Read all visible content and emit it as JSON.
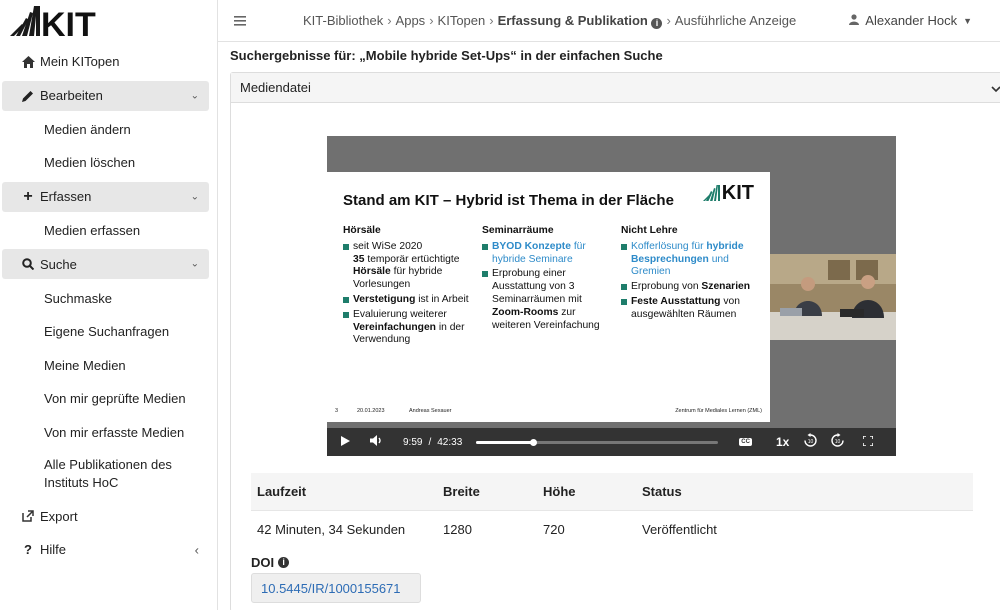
{
  "header": {
    "breadcrumb": [
      "KIT-Bibliothek",
      "Apps",
      "KITopen",
      "Erfassung & Publikation",
      "Ausführliche Anzeige"
    ],
    "user": "Alexander Hock"
  },
  "sidebar": {
    "logo_text": "KIT",
    "items": [
      {
        "label": "Mein KITopen",
        "icon": "home-icon"
      },
      {
        "label": "Bearbeiten",
        "icon": "pencil-icon"
      },
      {
        "label": "Medien ändern"
      },
      {
        "label": "Medien löschen"
      },
      {
        "label": "Erfassen",
        "icon": "plus-icon"
      },
      {
        "label": "Medien erfassen"
      },
      {
        "label": "Suche",
        "icon": "search-icon"
      },
      {
        "label": "Suchmaske"
      },
      {
        "label": "Eigene Suchanfragen"
      },
      {
        "label": "Meine Medien"
      },
      {
        "label": "Von mir geprüfte Medien"
      },
      {
        "label": "Von mir erfasste Medien"
      },
      {
        "label": "Alle Publikationen des Instituts HoC"
      },
      {
        "label": "Export",
        "icon": "external-link-icon"
      },
      {
        "label": "Hilfe",
        "icon": "question-icon"
      }
    ]
  },
  "main": {
    "search_title": "Suchergebnisse für: „Mobile hybride Set-Ups“ in der einfachen Suche",
    "panel_title": "Mediendatei",
    "video": {
      "slide_title": "Stand am KIT – Hybrid ist Thema in der Fläche",
      "slide_logo": "KIT",
      "col1_head": "Hörsäle",
      "col1_b1_a": "seit WiSe 2020",
      "col1_b1_b": "35",
      "col1_b1_c": " temporär ertüchtigte",
      "col1_b1_d": "Hörsäle",
      "col1_b1_e": " für hybride Vorlesungen",
      "col1_b2_a": "Verstetigung",
      "col1_b2_b": " ist in Arbeit",
      "col1_b3_a": "Evaluierung weiterer ",
      "col1_b3_b": "Vereinfachungen",
      "col1_b3_c": " in der Verwendung",
      "col2_head": "Seminarräume",
      "col2_b1_a": "BYOD Konzepte",
      "col2_b1_b": " für hybride Seminare",
      "col2_b2_a": "Erprobung einer Ausstattung von 3 Seminarräumen mit ",
      "col2_b2_b": "Zoom-Rooms",
      "col2_b2_c": " zur weiteren Vereinfachung",
      "col3_head": "Nicht Lehre",
      "col3_b1_a": "Kofferlösung für ",
      "col3_b1_b": "hybride Besprechungen",
      "col3_b1_c": " und Gremien",
      "col3_b2_a": "Erprobung von ",
      "col3_b2_b": "Szenarien",
      "col3_b3_a": "Feste Ausstattung",
      "col3_b3_b": " von ausgewählten Räumen",
      "foot_page": "3",
      "foot_date": "20.01.2023",
      "foot_author": "Andreas Sexauer",
      "foot_org": "Zentrum für Mediales Lernen (ZML)",
      "time_current": "9:59",
      "time_sep": "/",
      "time_total": "42:33",
      "progress": 0.235,
      "speed": "1x",
      "cc": "CC"
    },
    "table": {
      "headers": [
        "Laufzeit",
        "Breite",
        "Höhe",
        "Status"
      ],
      "row": [
        "42 Minuten, 34 Sekunden",
        "1280",
        "720",
        "Veröffentlicht"
      ]
    },
    "doi_label": "DOI",
    "doi_value": "10.5445/IR/1000155671"
  }
}
